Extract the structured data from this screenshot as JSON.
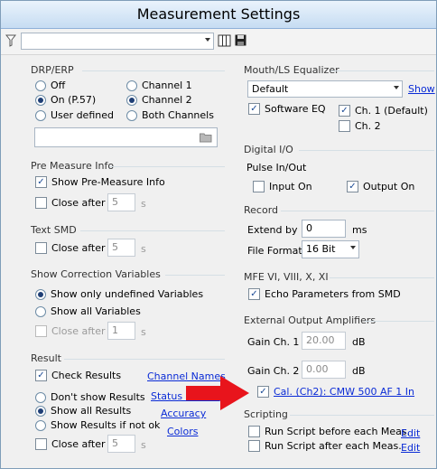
{
  "window": {
    "title": "Measurement Settings"
  },
  "toolbar": {
    "filter_value": "",
    "icons": [
      "filter-icon",
      "columns-icon",
      "save-icon"
    ]
  },
  "drp": {
    "title": "DRP/ERP",
    "options": [
      "Off",
      "On (P.57)",
      "User defined"
    ],
    "selected": "On (P.57)",
    "channels": [
      "Channel 1",
      "Channel 2",
      "Both Channels"
    ],
    "channel_selected": "Channel 2",
    "path_value": ""
  },
  "pre_measure": {
    "title": "Pre Measure Info",
    "show_label": "Show Pre-Measure Info",
    "show_checked": true,
    "close_label": "Close after",
    "close_value": "5",
    "unit": "s"
  },
  "text_smd": {
    "title": "Text SMD",
    "close_label": "Close after",
    "close_value": "5",
    "unit": "s"
  },
  "correction": {
    "title": "Show Correction Variables",
    "options": [
      "Show only undefined Variables",
      "Show all Variables"
    ],
    "selected": "Show only undefined Variables",
    "close_label": "Close after",
    "close_value": "1",
    "unit": "s"
  },
  "result": {
    "title": "Result",
    "check_label": "Check Results",
    "check_checked": true,
    "options": [
      "Don't show Results",
      "Show all Results",
      "Show Results if not ok"
    ],
    "selected": "Show all Results",
    "close_label": "Close after",
    "close_value": "5",
    "unit": "s",
    "links": [
      "Channel Names",
      "Status Names",
      "Accuracy",
      "Colors"
    ]
  },
  "mouth_eq": {
    "title": "Mouth/LS Equalizer",
    "selected": "Default",
    "show_link": "Show",
    "software_eq_label": "Software EQ",
    "software_eq_checked": true,
    "ch1_label": "Ch. 1 (Default)",
    "ch1_checked": true,
    "ch2_label": "Ch. 2",
    "ch2_checked": false
  },
  "digital_io": {
    "title": "Digital I/O",
    "subtitle": "Pulse In/Out",
    "input_label": "Input On",
    "input_checked": false,
    "output_label": "Output On",
    "output_checked": true
  },
  "record": {
    "title": "Record",
    "extend_label": "Extend by",
    "extend_value": "0",
    "extend_unit": "ms",
    "format_label": "File Format",
    "format_value": "16 Bit"
  },
  "mfe": {
    "title": "MFE VI, VIII, X, XI",
    "echo_label": "Echo Parameters from SMD",
    "echo_checked": true
  },
  "amplifiers": {
    "title": "External Output Amplifiers",
    "gain1_label": "Gain Ch. 1",
    "gain1_value": "20.00",
    "gain2_label": "Gain Ch. 2",
    "gain2_value": "0.00",
    "unit": "dB",
    "cal_label": "Cal. (Ch2): CMW 500 AF 1 In",
    "cal_checked": true
  },
  "scripting": {
    "title": "Scripting",
    "before_label": "Run Script before each Meas.",
    "after_label": "Run Script after each Meas.",
    "edit_label": "Edit"
  },
  "colors": {
    "link": "#0a2bd6",
    "arrow": "#e8141c",
    "title_bar": "#c6dcf2"
  }
}
